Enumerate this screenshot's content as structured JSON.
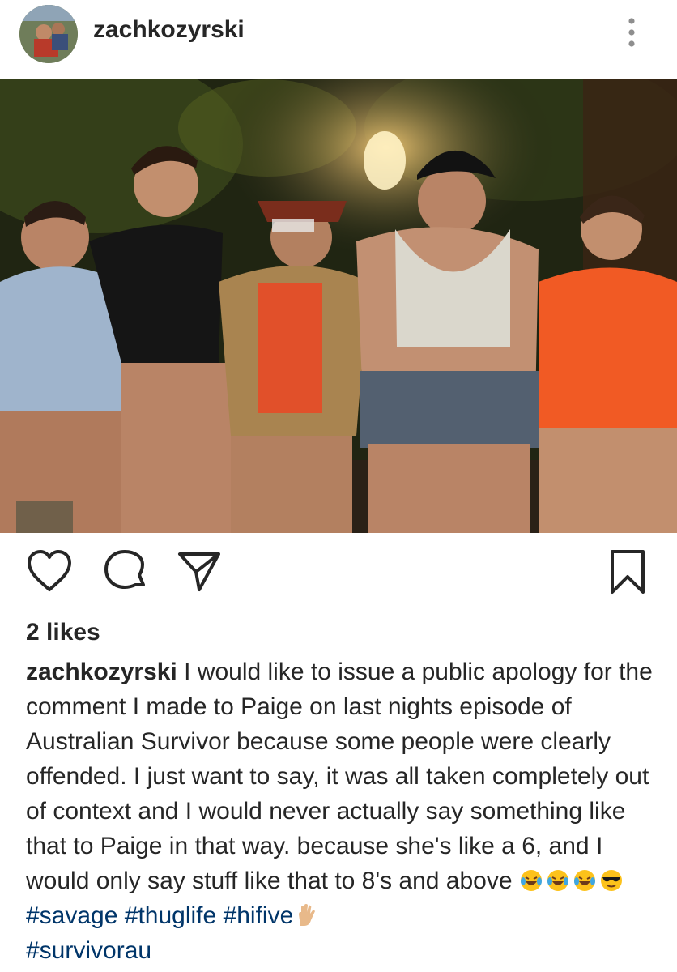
{
  "header": {
    "username": "zachkozyrski",
    "avatar_icon": "profile-avatar",
    "more_icon": "more-vertical-icon"
  },
  "post": {
    "photo_description": "",
    "actions": {
      "like_icon": "heart-icon",
      "comment_icon": "comment-icon",
      "share_icon": "send-icon",
      "save_icon": "bookmark-icon"
    },
    "likes": "2 likes",
    "caption": {
      "username": "zachkozyrski",
      "text": "I would like to issue a public apology for the comment I made to Paige on last nights episode of Australian Survivor because some people were clearly offended. I just want to say, it was all taken completely out of context and I would never actually say something like that to Paige in that way. because she's like a 6, and I would only say stuff like that to 8's and above",
      "emojis": [
        "tears-of-joy",
        "tears-of-joy",
        "tears-of-joy",
        "sunglasses"
      ],
      "hashtags": [
        "#savage",
        "#thuglife",
        "#hifive",
        "#survivorau"
      ],
      "trailing_emoji": "raised-hand"
    }
  },
  "colors": {
    "text": "#262626",
    "hashtag": "#003569",
    "background": "#ffffff"
  }
}
